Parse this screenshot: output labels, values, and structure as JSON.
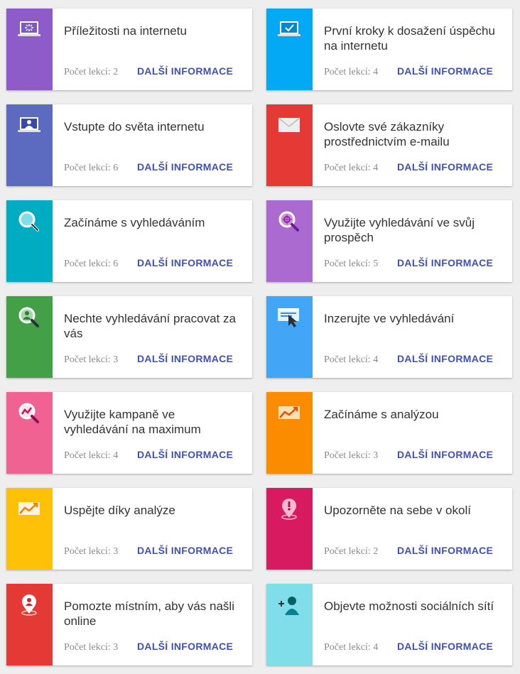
{
  "lessons_prefix": "Počet lekcí:",
  "more_label": "DALŠÍ INFORMACE",
  "courses": [
    {
      "title": "Příležitosti na internetu",
      "lessons": "Počet lekcí: 2",
      "color": "#8e5cc8",
      "icon": "laptop-sparkle-icon"
    },
    {
      "title": "První kroky k dosažení úspěchu na internetu",
      "lessons": "Počet lekcí: 4",
      "color": "#03a9f4",
      "icon": "laptop-check-icon"
    },
    {
      "title": "Vstupte do světa internetu",
      "lessons": "Počet lekcí: 6",
      "color": "#5c6bc0",
      "icon": "laptop-user-icon"
    },
    {
      "title": "Oslovte své zákazníky prostřednictvím e-mailu",
      "lessons": "Počet lekcí: 4",
      "color": "#e53935",
      "icon": "envelope-icon"
    },
    {
      "title": "Začínáme s vyhledáváním",
      "lessons": "Počet lekcí: 6",
      "color": "#00acc1",
      "icon": "magnifier-icon"
    },
    {
      "title": "Využijte vyhledávání ve svůj prospěch",
      "lessons": "Počet lekcí: 5",
      "color": "#ab6ad0",
      "icon": "magnifier-target-icon"
    },
    {
      "title": "Nechte vyhledávání pracovat za vás",
      "lessons": "Počet lekcí: 3",
      "color": "#43a047",
      "icon": "magnifier-user-icon"
    },
    {
      "title": "Inzerujte ve vyhledávání",
      "lessons": "Počet lekcí: 4",
      "color": "#42a5f5",
      "icon": "ad-cursor-icon"
    },
    {
      "title": "Využijte kampaně ve vyhledávání na maximum",
      "lessons": "Počet lekcí: 4",
      "color": "#f06292",
      "icon": "magnifier-trend-icon"
    },
    {
      "title": "Začínáme s analýzou",
      "lessons": "Počet lekcí: 3",
      "color": "#fb8c00",
      "icon": "trend-chart-icon"
    },
    {
      "title": "Uspějte díky analýze",
      "lessons": "Počet lekcí: 3",
      "color": "#ffc107",
      "icon": "trend-up-icon"
    },
    {
      "title": "Upozorněte na sebe v okolí",
      "lessons": "Počet lekcí: 2",
      "color": "#d81b60",
      "icon": "location-alert-icon"
    },
    {
      "title": "Pomozte místním, aby vás našli online",
      "lessons": "Počet lekcí: 3",
      "color": "#e53935",
      "icon": "location-user-icon"
    },
    {
      "title": "Objevte možnosti sociálních sítí",
      "lessons": "Počet lekcí: 4",
      "color": "#80deea",
      "icon": "add-user-icon"
    }
  ]
}
